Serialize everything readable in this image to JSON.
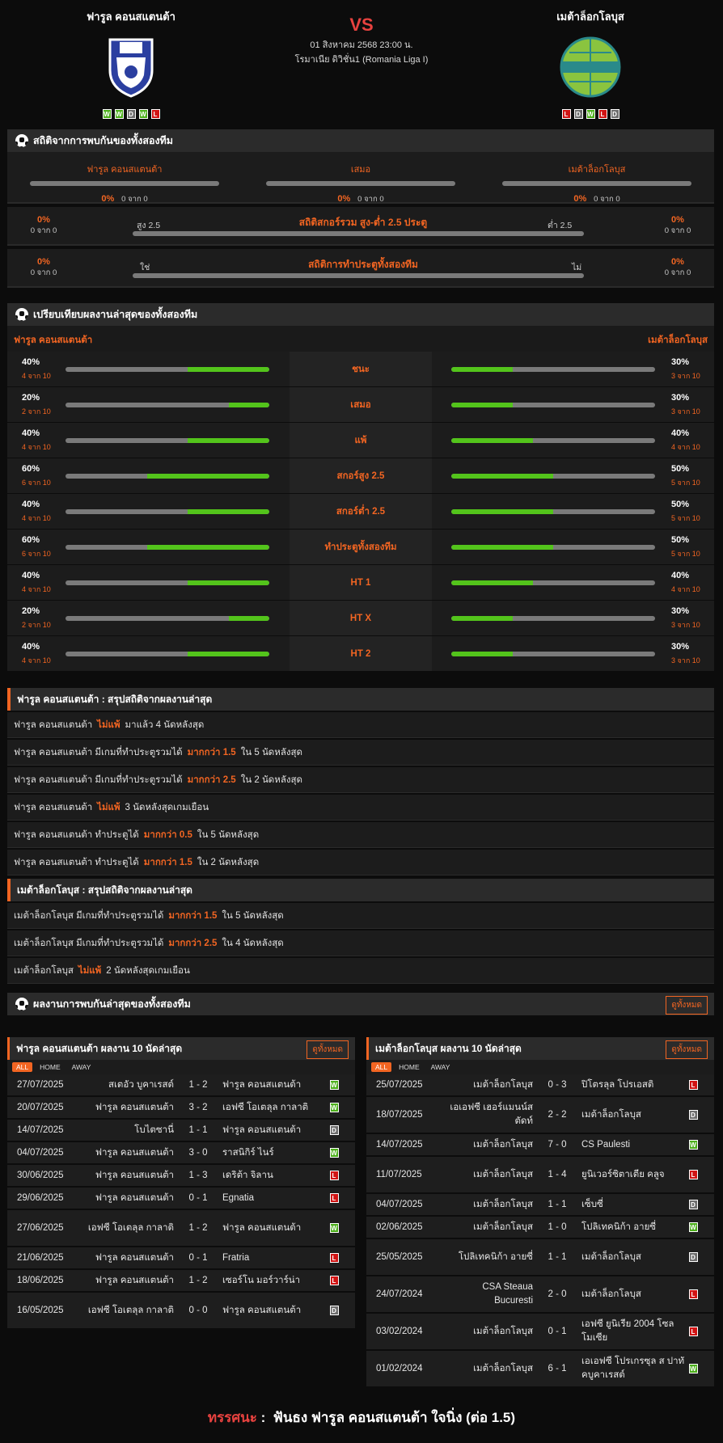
{
  "home": {
    "name": "ฟารูล คอนสแตนต้า",
    "form": [
      "W",
      "W",
      "D",
      "W",
      "L"
    ]
  },
  "away": {
    "name": "เมต้าล็อกโลบุส",
    "form": [
      "L",
      "D",
      "W",
      "L",
      "D"
    ]
  },
  "vs": "VS",
  "match_date": "01 สิงหาคม 2568 23:00 น.",
  "league": "โรมาเนีย ดิวิชั่น1 (Romania Liga I)",
  "h2h": {
    "title": "สถิติจากการพบกันของทั้งสองทีม",
    "cols": [
      {
        "label": "ฟารูล คอนสแตนต้า",
        "pct": "0%",
        "count": "0 จาก 0"
      },
      {
        "label": "เสมอ",
        "pct": "0%",
        "count": "0 จาก 0"
      },
      {
        "label": "เมต้าล็อกโลบุส",
        "pct": "0%",
        "count": "0 จาก 0"
      }
    ],
    "ou": {
      "title": "สถิติสกอร์รวม สูง-ต่ำ 2.5 ประตู",
      "left_label": "สูง 2.5",
      "right_label": "ต่ำ 2.5",
      "lp": "0%",
      "lc": "0 จาก 0",
      "rp": "0%",
      "rc": "0 จาก 0"
    },
    "btts": {
      "title": "สถิติการทำประตูทั้งสองทีม",
      "left_label": "ใช่",
      "right_label": "ไม่",
      "lp": "0%",
      "lc": "0 จาก 0",
      "rp": "0%",
      "rc": "0 จาก 0"
    }
  },
  "compare": {
    "title": "เปรียบเทียบผลงานล่าสุดของทั้งสองทีม",
    "home_label": "ฟารูล คอนสแตนต้า",
    "away_label": "เมต้าล็อกโลบุส",
    "rows": [
      {
        "label": "ชนะ",
        "hp": "40%",
        "hc": "4 จาก 10",
        "hv": 0.4,
        "ap": "30%",
        "ac": "3 จาก 10",
        "av": 0.3
      },
      {
        "label": "เสมอ",
        "hp": "20%",
        "hc": "2 จาก 10",
        "hv": 0.2,
        "ap": "30%",
        "ac": "3 จาก 10",
        "av": 0.3
      },
      {
        "label": "แพ้",
        "hp": "40%",
        "hc": "4 จาก 10",
        "hv": 0.4,
        "ap": "40%",
        "ac": "4 จาก 10",
        "av": 0.4
      },
      {
        "label": "สกอร์สูง 2.5",
        "hp": "60%",
        "hc": "6 จาก 10",
        "hv": 0.6,
        "ap": "50%",
        "ac": "5 จาก 10",
        "av": 0.5
      },
      {
        "label": "สกอร์ต่ำ 2.5",
        "hp": "40%",
        "hc": "4 จาก 10",
        "hv": 0.4,
        "ap": "50%",
        "ac": "5 จาก 10",
        "av": 0.5
      },
      {
        "label": "ทำประตูทั้งสองทีม",
        "hp": "60%",
        "hc": "6 จาก 10",
        "hv": 0.6,
        "ap": "50%",
        "ac": "5 จาก 10",
        "av": 0.5
      },
      {
        "label": "HT 1",
        "hp": "40%",
        "hc": "4 จาก 10",
        "hv": 0.4,
        "ap": "40%",
        "ac": "4 จาก 10",
        "av": 0.4
      },
      {
        "label": "HT X",
        "hp": "20%",
        "hc": "2 จาก 10",
        "hv": 0.2,
        "ap": "30%",
        "ac": "3 จาก 10",
        "av": 0.3
      },
      {
        "label": "HT 2",
        "hp": "40%",
        "hc": "4 จาก 10",
        "hv": 0.4,
        "ap": "30%",
        "ac": "3 จาก 10",
        "av": 0.3
      }
    ]
  },
  "home_summary": {
    "title": "ฟารูล คอนสแตนต้า : สรุปสถิติจากผลงานล่าสุด",
    "items": [
      {
        "pre": "ฟารูล คอนสแตนต้า",
        "hl": "ไม่แพ้",
        "post": "มาแล้ว 4 นัดหลังสุด"
      },
      {
        "pre": "ฟารูล คอนสแตนต้า มีเกมที่ทำประตูรวมได้",
        "hl": "มากกว่า 1.5",
        "post": "ใน 5 นัดหลังสุด"
      },
      {
        "pre": "ฟารูล คอนสแตนต้า มีเกมที่ทำประตูรวมได้",
        "hl": "มากกว่า 2.5",
        "post": "ใน 2 นัดหลังสุด"
      },
      {
        "pre": "ฟารูล คอนสแตนต้า",
        "hl": "ไม่แพ้",
        "post": "3 นัดหลังสุดเกมเยือน"
      },
      {
        "pre": "ฟารูล คอนสแตนต้า ทำประตูได้",
        "hl": "มากกว่า 0.5",
        "post": "ใน 5 นัดหลังสุด"
      },
      {
        "pre": "ฟารูล คอนสแตนต้า ทำประตูได้",
        "hl": "มากกว่า 1.5",
        "post": "ใน 2 นัดหลังสุด"
      }
    ]
  },
  "away_summary": {
    "title": "เมต้าล็อกโลบุส : สรุปสถิติจากผลงานล่าสุด",
    "items": [
      {
        "pre": "เมต้าล็อกโลบุส มีเกมที่ทำประตูรวมได้",
        "hl": "มากกว่า 1.5",
        "post": "ใน 5 นัดหลังสุด"
      },
      {
        "pre": "เมต้าล็อกโลบุส มีเกมที่ทำประตูรวมได้",
        "hl": "มากกว่า 2.5",
        "post": "ใน 4 นัดหลังสุด"
      },
      {
        "pre": "เมต้าล็อกโลบุส",
        "hl": "ไม่แพ้",
        "post": "2 นัดหลังสุดเกมเยือน"
      }
    ]
  },
  "recent": {
    "title": "ผลงานการพบกันล่าสุดของทั้งสองทีม",
    "view_all": "ดูทั้งหมด"
  },
  "tabs": [
    "ALL",
    "HOME",
    "AWAY"
  ],
  "home_matches": {
    "title": "ฟารูล คอนสแตนต้า ผลงาน 10 นัดล่าสุด",
    "view_all": "ดูทั้งหมด",
    "rows": [
      {
        "d": "27/07/2025",
        "h": "สเตอัว บูคาเรสต์",
        "s": "1 - 2",
        "a": "ฟารูล คอนสแตนต้า",
        "r": "W"
      },
      {
        "d": "20/07/2025",
        "h": "ฟารูล คอนสแตนต้า",
        "s": "3 - 2",
        "a": "เอฟซี โอเตลุล กาลาติ",
        "r": "W"
      },
      {
        "d": "14/07/2025",
        "h": "โบไตซานี่",
        "s": "1 - 1",
        "a": "ฟารูล คอนสแตนต้า",
        "r": "D"
      },
      {
        "d": "04/07/2025",
        "h": "ฟารูล คอนสแตนต้า",
        "s": "3 - 0",
        "a": "ราสนิกิร์ ไนร์",
        "r": "W"
      },
      {
        "d": "30/06/2025",
        "h": "ฟารูล คอนสแตนต้า",
        "s": "1 - 3",
        "a": "เดริต้า จิลาน",
        "r": "L"
      },
      {
        "d": "29/06/2025",
        "h": "ฟารูล คอนสแตนต้า",
        "s": "0 - 1",
        "a": "Egnatia",
        "r": "L"
      },
      {
        "d": "27/06/2025",
        "h": "เอฟซี โอเตลุล กาลาติ",
        "s": "1 - 2",
        "a": "ฟารูล คอนสแตนต้า",
        "r": "W"
      },
      {
        "d": "21/06/2025",
        "h": "ฟารูล คอนสแตนต้า",
        "s": "0 - 1",
        "a": "Fratria",
        "r": "L"
      },
      {
        "d": "18/06/2025",
        "h": "ฟารูล คอนสแตนต้า",
        "s": "1 - 2",
        "a": "เซอร์โน มอร์วาร์น่า",
        "r": "L"
      },
      {
        "d": "16/05/2025",
        "h": "เอฟซี โอเตลุล กาลาติ",
        "s": "0 - 0",
        "a": "ฟารูล คอนสแตนต้า",
        "r": "D"
      }
    ]
  },
  "away_matches": {
    "title": "เมต้าล็อกโลบุส ผลงาน 10 นัดล่าสุด",
    "view_all": "ดูทั้งหมด",
    "rows": [
      {
        "d": "25/07/2025",
        "h": "เมต้าล็อกโลบุส",
        "s": "0 - 3",
        "a": "ปิโตรลุล โปรเอสติ",
        "r": "L"
      },
      {
        "d": "18/07/2025",
        "h": "เอเอฟซี เฮอร์แมนน์สตัดท์",
        "s": "2 - 2",
        "a": "เมต้าล็อกโลบุส",
        "r": "D"
      },
      {
        "d": "14/07/2025",
        "h": "เมต้าล็อกโลบุส",
        "s": "7 - 0",
        "a": "CS Paulesti",
        "r": "W"
      },
      {
        "d": "11/07/2025",
        "h": "เมต้าล็อกโลบุส",
        "s": "1 - 4",
        "a": "ยูนิเวอร์ซิตาเตีย คลูจ",
        "r": "L"
      },
      {
        "d": "04/07/2025",
        "h": "เมต้าล็อกโลบุส",
        "s": "1 - 1",
        "a": "เซ็บซี่",
        "r": "D"
      },
      {
        "d": "02/06/2025",
        "h": "เมต้าล็อกโลบุส",
        "s": "1 - 0",
        "a": "โปลิเทคนิก้า อายซี่",
        "r": "W"
      },
      {
        "d": "25/05/2025",
        "h": "โปลิเทคนิก้า อายซี่",
        "s": "1 - 1",
        "a": "เมต้าล็อกโลบุส",
        "r": "D"
      },
      {
        "d": "24/07/2024",
        "h": "CSA Steaua Bucuresti",
        "s": "2 - 0",
        "a": "เมต้าล็อกโลบุส",
        "r": "L"
      },
      {
        "d": "03/02/2024",
        "h": "เมต้าล็อกโลบุส",
        "s": "0 - 1",
        "a": "เอฟซี ยูนิเรีย 2004 โซลโมเซีย",
        "r": "L"
      },
      {
        "d": "01/02/2024",
        "h": "เมต้าล็อกโลบุส",
        "s": "6 - 1",
        "a": "เอเอฟซี โปรเกรซุล ส ปาทัคบูคาเรสต์",
        "r": "W"
      }
    ]
  },
  "prediction": {
    "label": "ทรรศนะ",
    "sep": ":",
    "text": "ฟันธง ฟารูล คอนสแตนต้า ใจนิ่ง (ต่อ 1.5)"
  }
}
